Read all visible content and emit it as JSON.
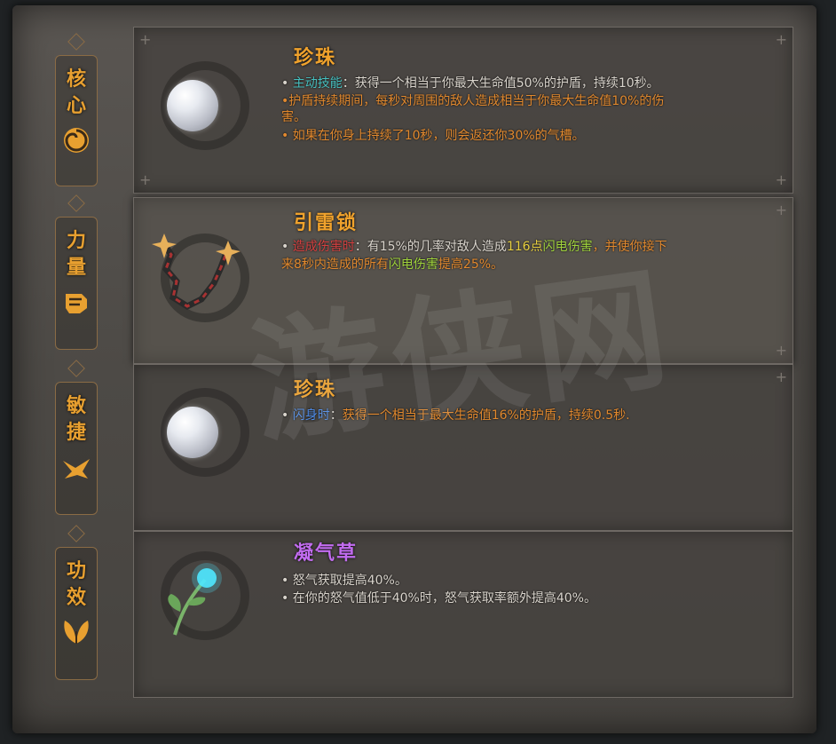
{
  "sidebar": {
    "tabs": [
      {
        "chars": [
          "核",
          "心"
        ],
        "icon": "spiral-icon"
      },
      {
        "chars": [
          "力",
          "量"
        ],
        "icon": "fist-icon"
      },
      {
        "chars": [
          "敏",
          "捷"
        ],
        "icon": "swallow-icon"
      },
      {
        "chars": [
          "功",
          "效"
        ],
        "icon": "leaf-icon"
      }
    ]
  },
  "items": [
    {
      "name": "珍珠",
      "icon": "pearl-icon",
      "lines": [
        {
          "bullet": "•",
          "label": "主动技能",
          "sep": "：",
          "text": "获得一个相当于你最大生命值50%的护盾，持续10秒。"
        },
        {
          "bullet": "•",
          "text": "护盾持续期间，每秒对周围的敌人造成相当于你最大生命值10%的伤"
        },
        {
          "text": "害。"
        },
        {
          "bullet": "•",
          "text": "如果在你身上持续了10秒，则会返还你30%的气槽。"
        }
      ]
    },
    {
      "name": "引雷锁",
      "icon": "chain-shuriken-icon",
      "lines": [
        {
          "bullet": "•",
          "label": "造成伤害时",
          "sep": "：",
          "t1": "有15%的几率对敌人造成",
          "num": "116点",
          "t2": "闪电伤害",
          "t3": "，并使你接下"
        },
        {
          "t4": "来8秒内造成的所有",
          "t5": "闪电伤害",
          "t6": "提高25%。"
        }
      ]
    },
    {
      "name": "珍珠",
      "icon": "pearl-icon",
      "lines": [
        {
          "bullet": "•",
          "label": "闪身时",
          "sep": "：",
          "text": "获得一个相当于最大生命值16%的护盾，持续0.5秒."
        }
      ]
    },
    {
      "name": "凝气草",
      "icon": "glowing-herb-icon",
      "lines": [
        {
          "bullet": "•",
          "text": "怒气获取提高40%。"
        },
        {
          "bullet": "•",
          "text": "在你的怒气值低于40%时，怒气获取率额外提高40%。"
        }
      ]
    }
  ],
  "watermark": "游侠网",
  "colors": {
    "title": "#f0a22c",
    "title_purple": "#c26cf0",
    "accent_orange": "#e2892e",
    "teal": "#46c0c0",
    "lightning": "#9fd23c"
  }
}
